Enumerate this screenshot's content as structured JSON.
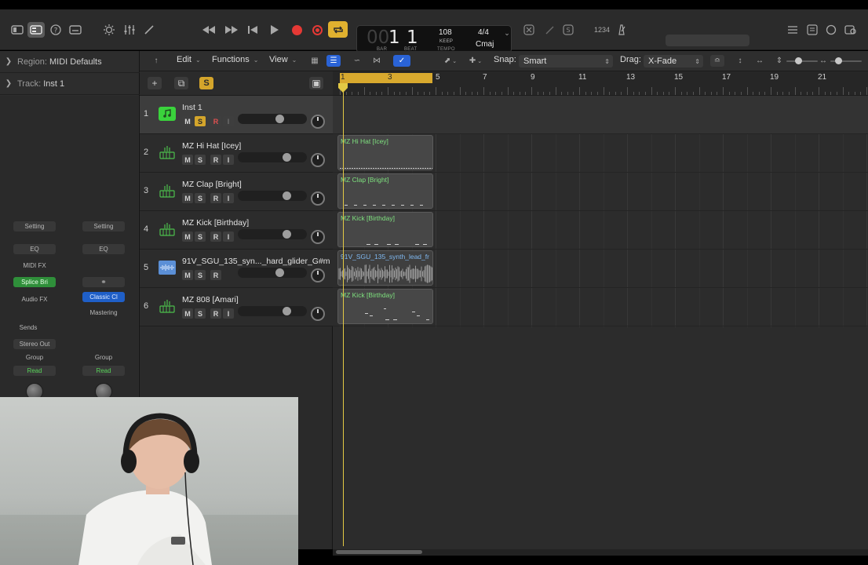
{
  "transport": {
    "bar": "1",
    "beat": "1",
    "bar_dim": "00",
    "bar_label": "BAR",
    "beat_label": "BEAT",
    "tempo": "108",
    "tempo_mode": "KEEP",
    "tempo_label": "TEMPO",
    "time_signature": "4/4",
    "key": "Cmaj",
    "count_in": "1234"
  },
  "inspector": {
    "region_key": "Region:",
    "region_value": "MIDI Defaults",
    "track_key": "Track:",
    "track_value": "Inst 1",
    "strip1": {
      "setting": "Setting",
      "eq": "EQ",
      "midi_fx": "MIDI FX",
      "instrument": "Splice Bri",
      "audio_fx": "Audio FX",
      "sends": "Sends",
      "output": "Stereo Out",
      "group": "Group",
      "automation": "Read"
    },
    "strip2": {
      "setting": "Setting",
      "eq": "EQ",
      "plugin": "Classic Cl",
      "mastering": "Mastering",
      "group": "Group",
      "automation": "Read"
    }
  },
  "menus": {
    "edit": "Edit",
    "functions": "Functions",
    "view": "View",
    "snap_label": "Snap:",
    "snap_value": "Smart",
    "drag_label": "Drag:",
    "drag_value": "X-Fade"
  },
  "toolbar": {
    "add": "+",
    "solo": "S"
  },
  "tracks": [
    {
      "num": "1",
      "name": "Inst 1",
      "m": "M",
      "s": "S",
      "r": "R",
      "i": "I"
    },
    {
      "num": "2",
      "name": "MZ Hi Hat [Icey]",
      "m": "M",
      "s": "S",
      "r": "R",
      "i": "I"
    },
    {
      "num": "3",
      "name": "MZ Clap [Bright]",
      "m": "M",
      "s": "S",
      "r": "R",
      "i": "I"
    },
    {
      "num": "4",
      "name": "MZ Kick [Birthday]",
      "m": "M",
      "s": "S",
      "r": "R",
      "i": "I"
    },
    {
      "num": "5",
      "name": "91V_SGU_135_syn..._hard_glider_G#m",
      "m": "M",
      "s": "S",
      "r": "R"
    },
    {
      "num": "6",
      "name": "MZ 808 [Amari]",
      "m": "M",
      "s": "S",
      "r": "R",
      "i": "I"
    }
  ],
  "ruler": [
    "1",
    "3",
    "5",
    "7",
    "9",
    "11",
    "13",
    "15",
    "17",
    "19",
    "21"
  ],
  "regions": [
    {
      "name": "MZ Hi Hat [Icey]"
    },
    {
      "name": "MZ Clap [Bright]"
    },
    {
      "name": "MZ Kick [Birthday]"
    },
    {
      "name": "91V_SGU_135_synth_lead_fr"
    },
    {
      "name": "MZ Kick [Birthday]"
    }
  ],
  "colors": {
    "accent_yellow": "#d4a52b",
    "record_red": "#e53935",
    "midi_region_text": "#7ee07e",
    "audio_region_text": "#7fb8f0",
    "selection_blue": "#2a63d6"
  },
  "icons": {
    "library": "library-icon",
    "inspector": "inspector-icon",
    "quick_help": "quick-help-icon",
    "toolbar": "toolbar-icon",
    "smart_controls": "smart-controls-icon",
    "mixer": "mixer-icon",
    "editors": "editors-icon",
    "rewind": "rewind-icon",
    "forward": "fast-forward-icon",
    "to_start": "go-to-start-icon",
    "play": "play-icon",
    "record": "record-icon",
    "capture": "capture-record-icon",
    "cycle": "cycle-icon",
    "tuner": "tuner-icon",
    "metronome": "metronome-icon",
    "list_editors": "list-editors-icon",
    "notepad": "notepad-icon",
    "loop_browser": "loop-browser-icon",
    "browsers": "browsers-icon"
  }
}
